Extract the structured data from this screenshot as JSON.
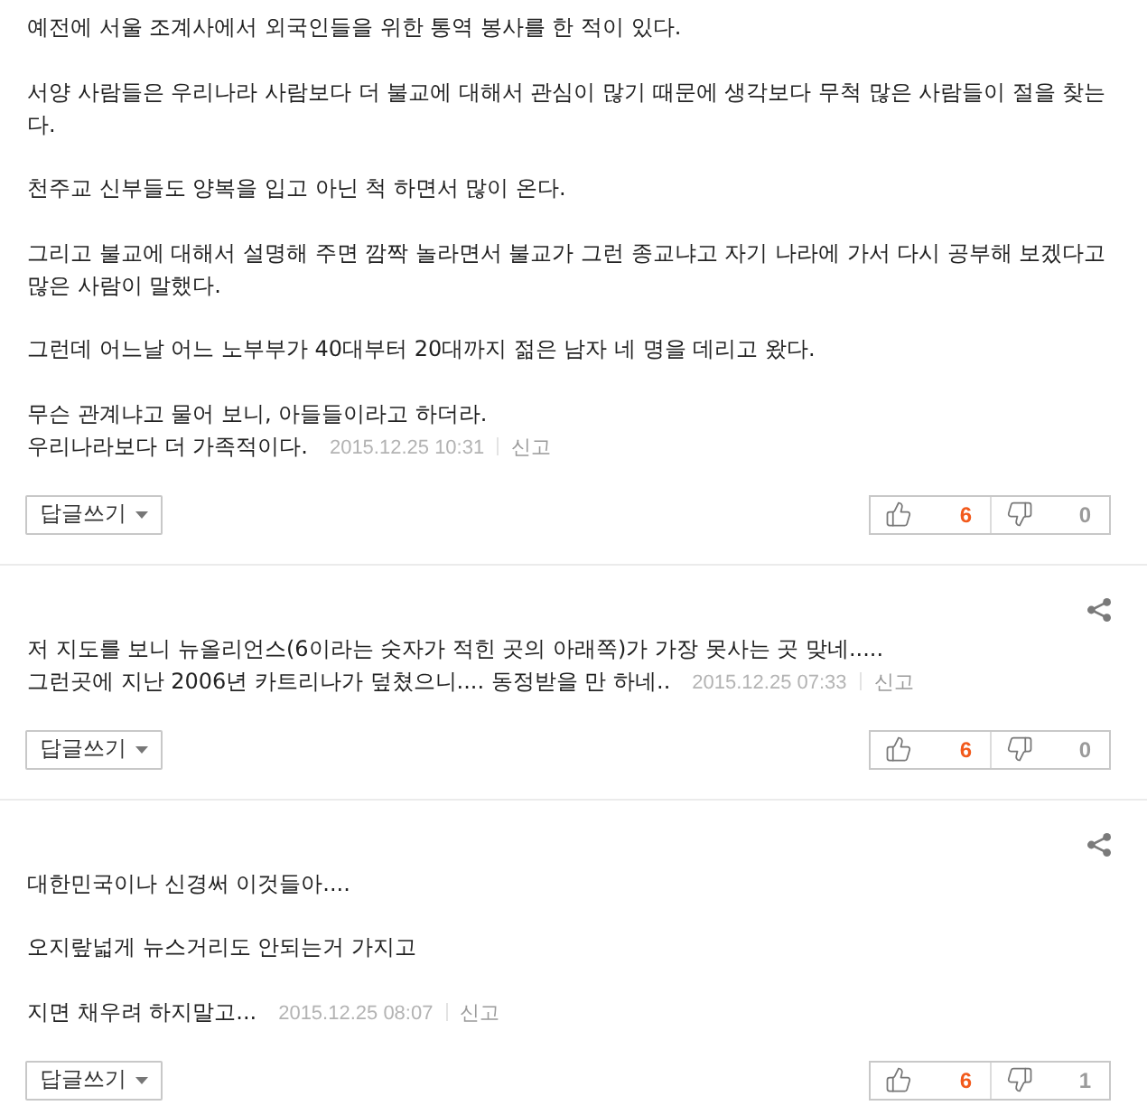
{
  "comments": [
    {
      "paragraphs": [
        [
          "예전에 서울 조계사에서 외국인들을 위한 통역 봉사를 한 적이 있다."
        ],
        [
          "서양 사람들은 우리나라 사람보다 더 불교에 대해서 관심이 많기 때문에 생각보다 무척 많은 사람들이 절을 찾는다."
        ],
        [
          "천주교 신부들도 양복을 입고 아닌 척 하면서 많이 온다."
        ],
        [
          "그리고 불교에 대해서 설명해 주면 깜짝 놀라면서 불교가 그런 종교냐고 자기 나라에 가서 다시 공부해 보겠다고 많은 사람이 말했다."
        ],
        [
          "그런데 어느날 어느 노부부가 40대부터 20대까지 젊은 남자 네 명을 데리고 왔다."
        ],
        [
          "무슨 관계냐고 물어 보니, 아들들이라고 하더라.",
          "우리나라보다 더 가족적이다."
        ]
      ],
      "date": "2015.12.25 10:31",
      "report": "신고",
      "reply_button": "답글쓰기",
      "likes": "6",
      "dislikes": "0"
    },
    {
      "share_button": true,
      "paragraphs": [
        [
          "저 지도를 보니 뉴올리언스(6이라는 숫자가 적힌 곳의 아래쪽)가 가장 못사는 곳 맞네.....",
          "그런곳에 지난 2006년 카트리나가 덮쳤으니.... 동정받을 만 하네.."
        ]
      ],
      "date": "2015.12.25 07:33",
      "report": "신고",
      "reply_button": "답글쓰기",
      "likes": "6",
      "dislikes": "0"
    },
    {
      "share_button": true,
      "paragraphs": [
        [
          "대한민국이나 신경써 이것들아...."
        ],
        [
          "오지랖넓게 뉴스거리도 안되는거 가지고"
        ],
        [
          "지면 채우려 하지말고..."
        ]
      ],
      "date": "2015.12.25 08:07",
      "report": "신고",
      "reply_button": "답글쓰기",
      "likes": "6",
      "dislikes": "1"
    }
  ]
}
